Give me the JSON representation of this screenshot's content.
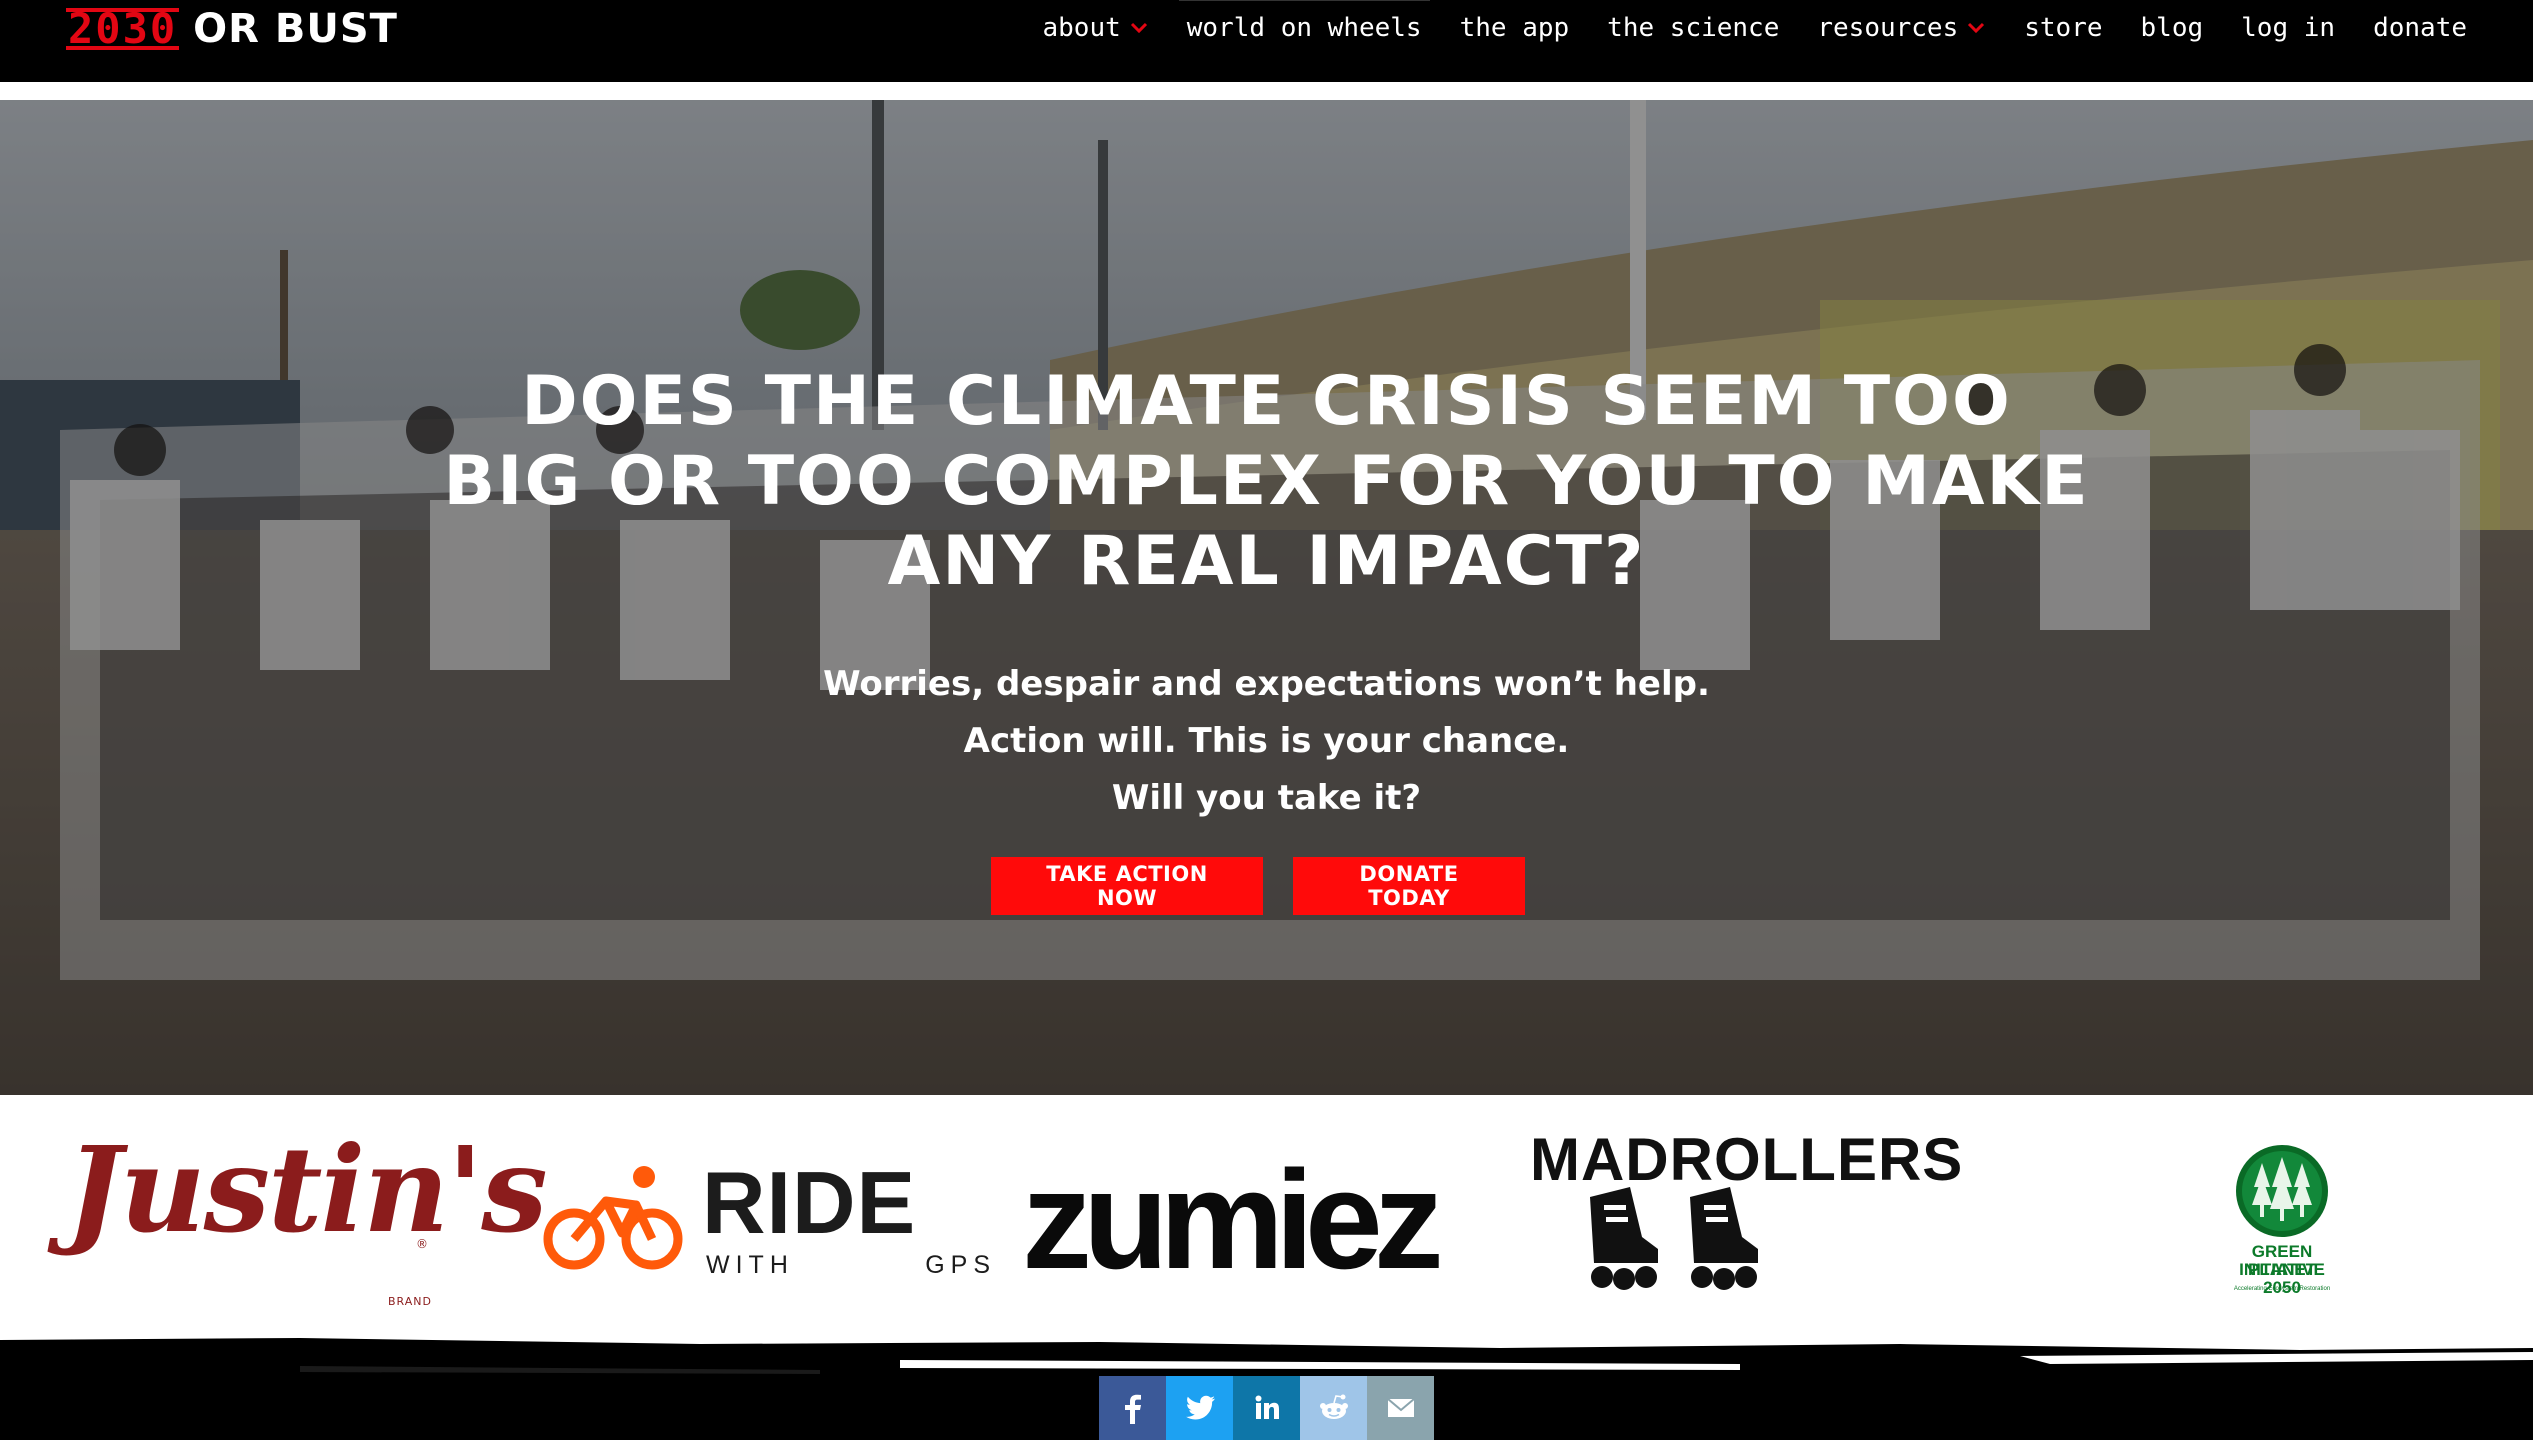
{
  "header": {
    "logo": {
      "number": "2030",
      "text": "OR BUST"
    },
    "nav": [
      {
        "label": "about",
        "has_dropdown": true
      },
      {
        "label": "world on wheels",
        "has_dropdown": false,
        "active": true
      },
      {
        "label": "the app",
        "has_dropdown": false
      },
      {
        "label": "the science",
        "has_dropdown": false
      },
      {
        "label": "resources",
        "has_dropdown": true
      },
      {
        "label": "store",
        "has_dropdown": false
      },
      {
        "label": "blog",
        "has_dropdown": false
      },
      {
        "label": "log in",
        "has_dropdown": false
      },
      {
        "label": "donate",
        "has_dropdown": false
      }
    ]
  },
  "hero": {
    "title": "DOES THE CLIMATE CRISIS SEEM TOO BIG OR TOO COMPLEX FOR YOU TO MAKE ANY REAL IMPACT?",
    "lines": [
      "Worries, despair and expectations won’t help.",
      "Action will. This is your chance.",
      "Will you take it?"
    ],
    "buttons": {
      "take_action": "TAKE ACTION NOW",
      "donate": "DONATE TODAY"
    }
  },
  "sponsors": {
    "justins": {
      "word": "Justin's",
      "reg": "®",
      "brand": "BRAND"
    },
    "ride": {
      "word": "RIDE",
      "sub_left": "WITH",
      "sub_right": "GPS"
    },
    "zumiez": {
      "word": "zumiez"
    },
    "madrollers": {
      "word": "MADROLLERS"
    },
    "gpi": {
      "line1": "GREEN PLANET",
      "line2": "INITIATIVE 2050",
      "line3": "Accelerating Ecosystem Restoration"
    }
  },
  "colors": {
    "brand_red": "#e30613",
    "button_red": "#ff0a0a",
    "facebook": "#3b5998",
    "twitter": "#1da1f2",
    "linkedin": "#0e76a8",
    "reddit": "#9fc5e8",
    "email": "#8aa4ad"
  },
  "share": [
    {
      "network": "facebook",
      "icon": "facebook-icon"
    },
    {
      "network": "twitter",
      "icon": "twitter-icon"
    },
    {
      "network": "linkedin",
      "icon": "linkedin-icon"
    },
    {
      "network": "reddit",
      "icon": "reddit-icon"
    },
    {
      "network": "email",
      "icon": "email-icon"
    }
  ]
}
